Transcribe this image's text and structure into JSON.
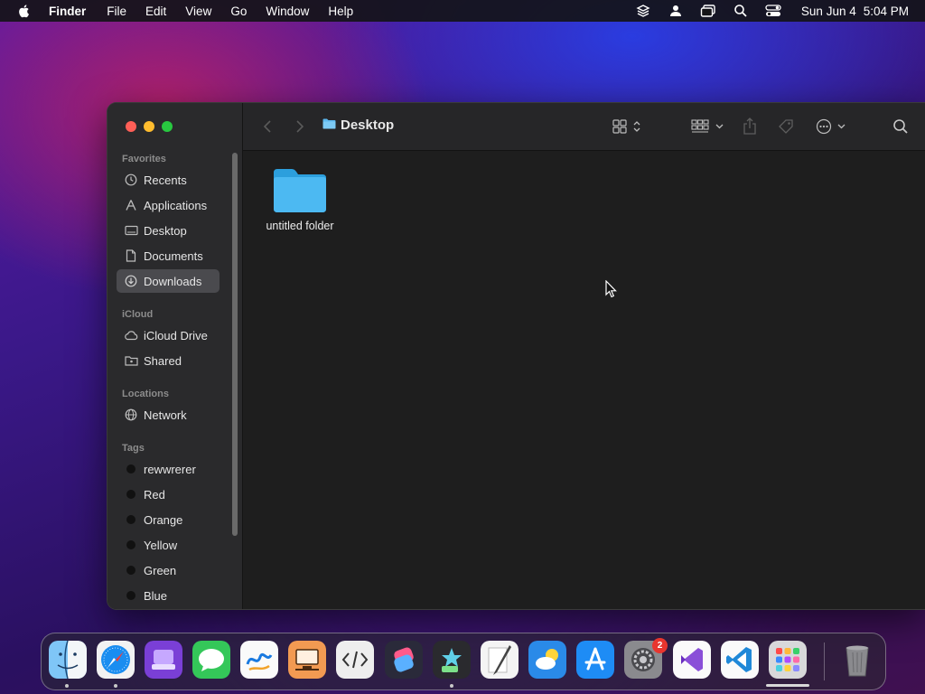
{
  "menubar": {
    "app_name": "Finder",
    "menus": [
      "File",
      "Edit",
      "View",
      "Go",
      "Window",
      "Help"
    ],
    "clock_date": "Sun Jun 4",
    "clock_time": "5:04 PM"
  },
  "window": {
    "title": "Desktop",
    "sidebar": {
      "favorites_label": "Favorites",
      "favorites": [
        {
          "label": "Recents",
          "icon": "clock-icon"
        },
        {
          "label": "Applications",
          "icon": "applications-icon"
        },
        {
          "label": "Desktop",
          "icon": "desktop-icon"
        },
        {
          "label": "Documents",
          "icon": "document-icon"
        },
        {
          "label": "Downloads",
          "icon": "download-icon",
          "selected": true
        }
      ],
      "icloud_label": "iCloud",
      "icloud": [
        {
          "label": "iCloud Drive",
          "icon": "cloud-icon"
        },
        {
          "label": "Shared",
          "icon": "shared-folder-icon"
        }
      ],
      "locations_label": "Locations",
      "locations": [
        {
          "label": "Network",
          "icon": "globe-icon"
        }
      ],
      "tags_label": "Tags",
      "tags": [
        "rewwrerer",
        "Red",
        "Orange",
        "Yellow",
        "Green",
        "Blue"
      ]
    },
    "items": [
      {
        "name": "untitled folder",
        "type": "folder"
      }
    ]
  },
  "dock": {
    "apps": [
      "Finder",
      "Safari",
      "Mail",
      "Messages",
      "Freeform",
      "Keynote",
      "Script Editor",
      "Shortcuts",
      "Apple Configurator",
      "Script Editor 2",
      "Weather",
      "App Store",
      "System Settings",
      "Visual Studio",
      "Visual Studio Code",
      "Launchpad",
      "Trash"
    ],
    "system_settings_badge": "2"
  },
  "colors": {
    "sidebar_bg": "#2a2a2c",
    "content_bg": "#1e1e1e",
    "folder_blue": "#3ab3f0",
    "selected_row": "#4a4a4e"
  }
}
